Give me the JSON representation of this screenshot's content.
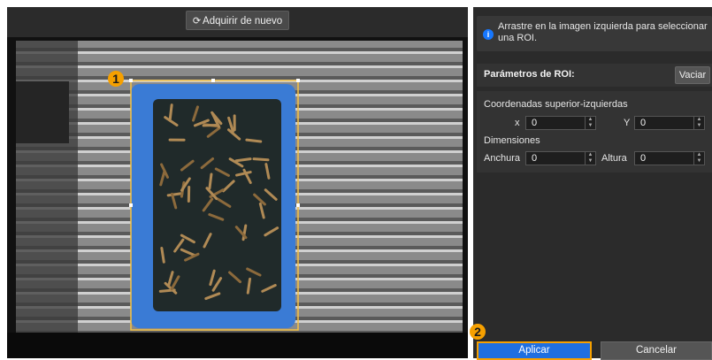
{
  "toolbar": {
    "reacquire_label": "Adquirir de nuevo",
    "reacquire_icon": "refresh-icon"
  },
  "info": {
    "text": "Arrastre en la imagen izquierda para seleccionar una ROI."
  },
  "roi": {
    "title": "Parámetros de ROI:",
    "clear_label": "Vaciar",
    "coords_label": "Coordenadas superior-izquierdas",
    "x_label": "x",
    "x_value": "0",
    "y_label": "Y",
    "y_value": "0",
    "dims_label": "Dimensiones",
    "width_label": "Anchura",
    "width_value": "0",
    "height_label": "Altura",
    "height_value": "0"
  },
  "actions": {
    "apply_label": "Aplicar",
    "cancel_label": "Cancelar"
  },
  "markers": {
    "one": "1",
    "two": "2"
  },
  "colors": {
    "accent": "#1f6fe0",
    "highlight": "#f6a000",
    "roi_outline": "#f6c142"
  }
}
